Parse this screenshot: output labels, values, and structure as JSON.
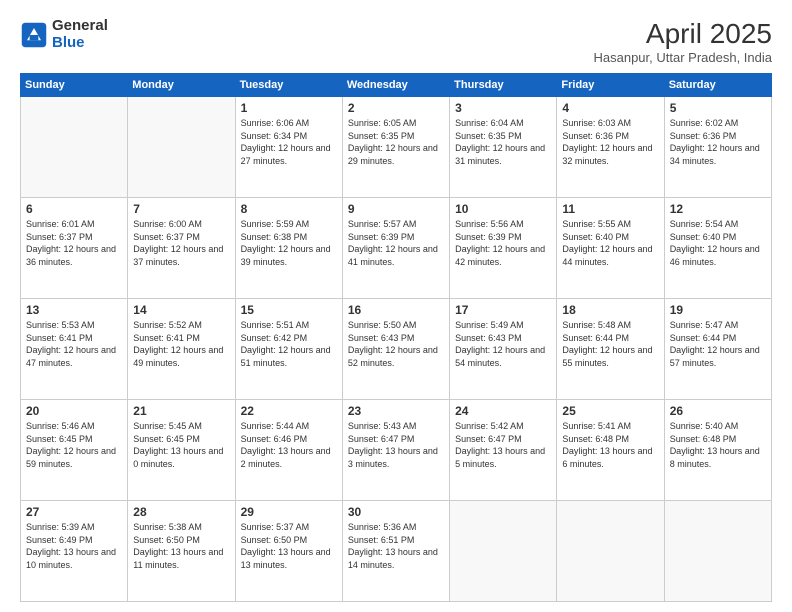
{
  "header": {
    "logo_general": "General",
    "logo_blue": "Blue",
    "title": "April 2025",
    "location": "Hasanpur, Uttar Pradesh, India"
  },
  "days_of_week": [
    "Sunday",
    "Monday",
    "Tuesday",
    "Wednesday",
    "Thursday",
    "Friday",
    "Saturday"
  ],
  "weeks": [
    [
      {
        "day": "",
        "sunrise": "",
        "sunset": "",
        "daylight": ""
      },
      {
        "day": "",
        "sunrise": "",
        "sunset": "",
        "daylight": ""
      },
      {
        "day": "1",
        "sunrise": "Sunrise: 6:06 AM",
        "sunset": "Sunset: 6:34 PM",
        "daylight": "Daylight: 12 hours and 27 minutes."
      },
      {
        "day": "2",
        "sunrise": "Sunrise: 6:05 AM",
        "sunset": "Sunset: 6:35 PM",
        "daylight": "Daylight: 12 hours and 29 minutes."
      },
      {
        "day": "3",
        "sunrise": "Sunrise: 6:04 AM",
        "sunset": "Sunset: 6:35 PM",
        "daylight": "Daylight: 12 hours and 31 minutes."
      },
      {
        "day": "4",
        "sunrise": "Sunrise: 6:03 AM",
        "sunset": "Sunset: 6:36 PM",
        "daylight": "Daylight: 12 hours and 32 minutes."
      },
      {
        "day": "5",
        "sunrise": "Sunrise: 6:02 AM",
        "sunset": "Sunset: 6:36 PM",
        "daylight": "Daylight: 12 hours and 34 minutes."
      }
    ],
    [
      {
        "day": "6",
        "sunrise": "Sunrise: 6:01 AM",
        "sunset": "Sunset: 6:37 PM",
        "daylight": "Daylight: 12 hours and 36 minutes."
      },
      {
        "day": "7",
        "sunrise": "Sunrise: 6:00 AM",
        "sunset": "Sunset: 6:37 PM",
        "daylight": "Daylight: 12 hours and 37 minutes."
      },
      {
        "day": "8",
        "sunrise": "Sunrise: 5:59 AM",
        "sunset": "Sunset: 6:38 PM",
        "daylight": "Daylight: 12 hours and 39 minutes."
      },
      {
        "day": "9",
        "sunrise": "Sunrise: 5:57 AM",
        "sunset": "Sunset: 6:39 PM",
        "daylight": "Daylight: 12 hours and 41 minutes."
      },
      {
        "day": "10",
        "sunrise": "Sunrise: 5:56 AM",
        "sunset": "Sunset: 6:39 PM",
        "daylight": "Daylight: 12 hours and 42 minutes."
      },
      {
        "day": "11",
        "sunrise": "Sunrise: 5:55 AM",
        "sunset": "Sunset: 6:40 PM",
        "daylight": "Daylight: 12 hours and 44 minutes."
      },
      {
        "day": "12",
        "sunrise": "Sunrise: 5:54 AM",
        "sunset": "Sunset: 6:40 PM",
        "daylight": "Daylight: 12 hours and 46 minutes."
      }
    ],
    [
      {
        "day": "13",
        "sunrise": "Sunrise: 5:53 AM",
        "sunset": "Sunset: 6:41 PM",
        "daylight": "Daylight: 12 hours and 47 minutes."
      },
      {
        "day": "14",
        "sunrise": "Sunrise: 5:52 AM",
        "sunset": "Sunset: 6:41 PM",
        "daylight": "Daylight: 12 hours and 49 minutes."
      },
      {
        "day": "15",
        "sunrise": "Sunrise: 5:51 AM",
        "sunset": "Sunset: 6:42 PM",
        "daylight": "Daylight: 12 hours and 51 minutes."
      },
      {
        "day": "16",
        "sunrise": "Sunrise: 5:50 AM",
        "sunset": "Sunset: 6:43 PM",
        "daylight": "Daylight: 12 hours and 52 minutes."
      },
      {
        "day": "17",
        "sunrise": "Sunrise: 5:49 AM",
        "sunset": "Sunset: 6:43 PM",
        "daylight": "Daylight: 12 hours and 54 minutes."
      },
      {
        "day": "18",
        "sunrise": "Sunrise: 5:48 AM",
        "sunset": "Sunset: 6:44 PM",
        "daylight": "Daylight: 12 hours and 55 minutes."
      },
      {
        "day": "19",
        "sunrise": "Sunrise: 5:47 AM",
        "sunset": "Sunset: 6:44 PM",
        "daylight": "Daylight: 12 hours and 57 minutes."
      }
    ],
    [
      {
        "day": "20",
        "sunrise": "Sunrise: 5:46 AM",
        "sunset": "Sunset: 6:45 PM",
        "daylight": "Daylight: 12 hours and 59 minutes."
      },
      {
        "day": "21",
        "sunrise": "Sunrise: 5:45 AM",
        "sunset": "Sunset: 6:45 PM",
        "daylight": "Daylight: 13 hours and 0 minutes."
      },
      {
        "day": "22",
        "sunrise": "Sunrise: 5:44 AM",
        "sunset": "Sunset: 6:46 PM",
        "daylight": "Daylight: 13 hours and 2 minutes."
      },
      {
        "day": "23",
        "sunrise": "Sunrise: 5:43 AM",
        "sunset": "Sunset: 6:47 PM",
        "daylight": "Daylight: 13 hours and 3 minutes."
      },
      {
        "day": "24",
        "sunrise": "Sunrise: 5:42 AM",
        "sunset": "Sunset: 6:47 PM",
        "daylight": "Daylight: 13 hours and 5 minutes."
      },
      {
        "day": "25",
        "sunrise": "Sunrise: 5:41 AM",
        "sunset": "Sunset: 6:48 PM",
        "daylight": "Daylight: 13 hours and 6 minutes."
      },
      {
        "day": "26",
        "sunrise": "Sunrise: 5:40 AM",
        "sunset": "Sunset: 6:48 PM",
        "daylight": "Daylight: 13 hours and 8 minutes."
      }
    ],
    [
      {
        "day": "27",
        "sunrise": "Sunrise: 5:39 AM",
        "sunset": "Sunset: 6:49 PM",
        "daylight": "Daylight: 13 hours and 10 minutes."
      },
      {
        "day": "28",
        "sunrise": "Sunrise: 5:38 AM",
        "sunset": "Sunset: 6:50 PM",
        "daylight": "Daylight: 13 hours and 11 minutes."
      },
      {
        "day": "29",
        "sunrise": "Sunrise: 5:37 AM",
        "sunset": "Sunset: 6:50 PM",
        "daylight": "Daylight: 13 hours and 13 minutes."
      },
      {
        "day": "30",
        "sunrise": "Sunrise: 5:36 AM",
        "sunset": "Sunset: 6:51 PM",
        "daylight": "Daylight: 13 hours and 14 minutes."
      },
      {
        "day": "",
        "sunrise": "",
        "sunset": "",
        "daylight": ""
      },
      {
        "day": "",
        "sunrise": "",
        "sunset": "",
        "daylight": ""
      },
      {
        "day": "",
        "sunrise": "",
        "sunset": "",
        "daylight": ""
      }
    ]
  ]
}
